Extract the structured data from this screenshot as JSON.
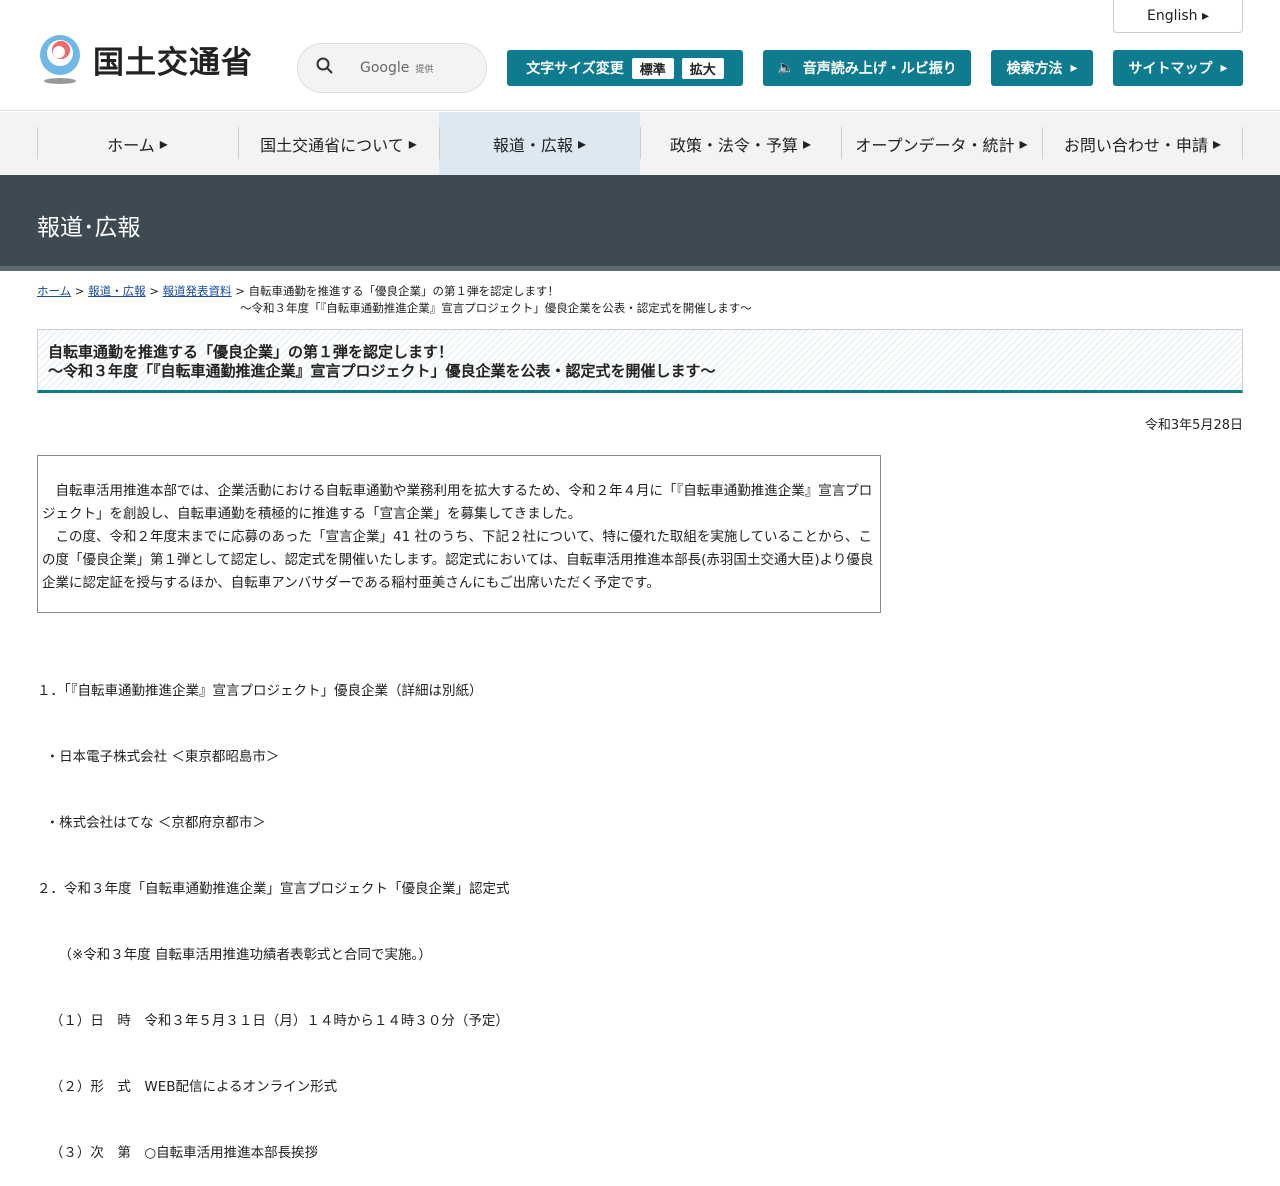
{
  "header": {
    "logo_text": "国土交通省",
    "english": "English",
    "search_provider": "Google",
    "search_suffix": "提供",
    "font_size_label": "文字サイズ変更",
    "font_standard": "標準",
    "font_large": "拡大",
    "speech": "音声読み上げ・ルビ振り",
    "search_method": "検索方法",
    "sitemap": "サイトマップ"
  },
  "nav": [
    "ホーム",
    "国土交通省について",
    "報道・広報",
    "政策・法令・予算",
    "オープンデータ・統計",
    "お問い合わせ・申請"
  ],
  "banner": "報道･広報",
  "breadcrumb": {
    "home": "ホーム",
    "press": "報道・広報",
    "releases": "報道発表資料",
    "current1": "自転車通勤を推進する「優良企業」の第１弾を認定します！",
    "current2": "～令和３年度「『自転車通勤推進企業』宣言プロジェクト」優良企業を公表・認定式を開催します～"
  },
  "title": {
    "line1": "自転車通勤を推進する「優良企業」の第１弾を認定します！",
    "line2": "～令和３年度「『自転車通勤推進企業』宣言プロジェクト」優良企業を公表・認定式を開催します～"
  },
  "date": "令和3年5月28日",
  "summary": "　自転車活用推進本部では、企業活動における自転車通勤や業務利用を拡大するため、令和２年４月に「『自転車通勤推進企業』宣言プロジェクト」を創設し、自転車通勤を積極的に推進する「宣言企業」を募集してきました。\n　この度、令和２年度末までに応募のあった「宣言企業」41 社のうち、下記２社について、特に優れた取組を実施していることから、この度「優良企業」第１弾として認定し、認定式を開催いたします。認定式においては、自転車活用推進本部長(赤羽国土交通大臣)より優良企業に認定証を授与するほか、自転車アンバサダーである稲村亜美さんにもご出席いただく予定です。",
  "body": [
    "１．「『自転車通勤推進企業』宣言プロジェクト」優良企業（詳細は別紙）",
    "  ・日本電子株式会社 ＜東京都昭島市＞",
    "  ・株式会社はてな ＜京都府京都市＞",
    "２．令和３年度「自転車通勤推進企業」宣言プロジェクト「優良企業」認定式",
    "     （※令和３年度 自転車活用推進功績者表彰式と合同で実施。）",
    "   （１）日　時　令和３年５月３１日（月）１４時から１４時３０分（予定）",
    "   （２）形　式　WEB配信によるオンライン形式",
    "   （３）次　第　○自転車活用推進本部長挨拶"
  ]
}
